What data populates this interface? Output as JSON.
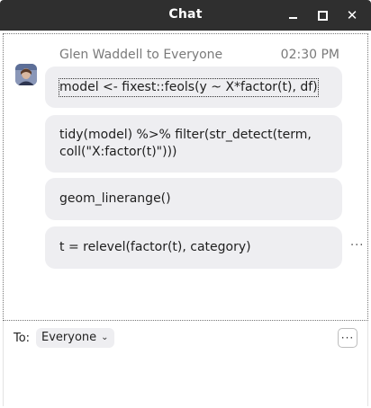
{
  "window": {
    "title": "Chat",
    "minimize_icon": "minimize-icon",
    "maximize_icon": "maximize-icon",
    "close_icon": "close-icon",
    "close_glyph": "✕"
  },
  "message_group": {
    "sender": "Glen Waddell to Everyone",
    "time": "02:30 PM",
    "avatar_icon": "user-avatar"
  },
  "messages": [
    {
      "text": "model <- fixest::feols(y ~ X*factor(t), df)"
    },
    {
      "text": "tidy(model) %>% filter(str_detect(term, coll(\"X:factor(t)\")))"
    },
    {
      "text": "geom_linerange()"
    },
    {
      "text": "t = relevel(factor(t), category)"
    }
  ],
  "message_more": "···",
  "composer": {
    "to_label": "To:",
    "recipient": "Everyone",
    "recipient_chevron": "chevron-down-icon",
    "options_glyph": "···"
  }
}
